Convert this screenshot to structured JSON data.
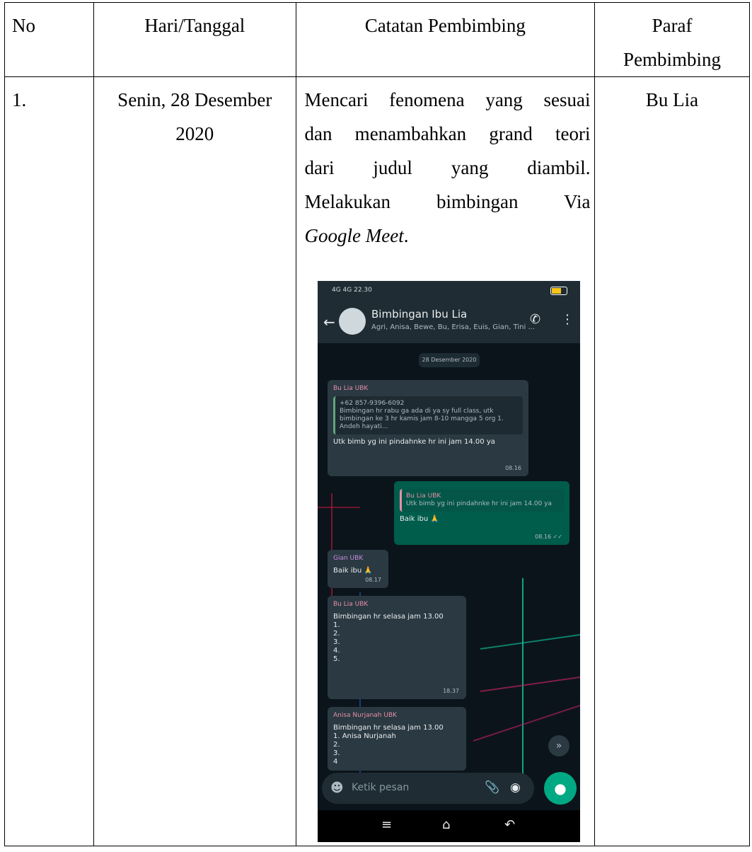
{
  "table": {
    "headers": {
      "no": "No",
      "date": "Hari/Tanggal",
      "note": "Catatan Pembimbing",
      "sign_line1": "Paraf",
      "sign_line2": "Pembimbing"
    },
    "rows": [
      {
        "no": "1.",
        "date_line1": "Senin, 28 Desember",
        "date_line2": "2020",
        "note_lines": [
          "Mencari fenomena yang sesuai",
          "dan menambahkan grand teori",
          "dari judul yang diambil.",
          "Melakukan bimbingan Via"
        ],
        "note_italic": "Google Meet",
        "note_italic_suffix": ".",
        "sign": "Bu Lia"
      }
    ]
  },
  "phone": {
    "status_left": "4G 4G 22.30",
    "group_name": "Bimbingan Ibu Lia",
    "members": "Agri, Anisa, Bewe, Bu, Erisa, Euis, Gian, Tini ...",
    "date_chip": "28 Desember 2020",
    "messages": [
      {
        "sender": "Bu Lia UBK",
        "quote_head": "+62 857-9396-6092",
        "quote_body": "Bimbingan hr rabu ga ada di ya sy full class, utk bimbingan ke 3 hr kamis jam 8-10 mangga 5 org 1. Andeh hayati...",
        "text": "Utk bimb yg ini pindahnke hr ini jam 14.00 ya",
        "time": "08.16"
      },
      {
        "quote_head": "Bu Lia UBK",
        "quote_body": "Utk bimb yg ini pindahnke hr ini jam 14.00 ya",
        "text": "Baik ibu 🙏",
        "time": "08.16 ✓✓"
      },
      {
        "sender": "Gian UBK",
        "text": "Baik ibu 🙏",
        "time": "08.17"
      },
      {
        "sender": "Bu Lia UBK",
        "text": "Bimbingan hr selasa jam 13.00\n1.\n2.\n3.\n4.\n5.",
        "time": "18.37"
      },
      {
        "sender": "Anisa Nurjanah UBK",
        "text": "Bimbingan hr selasa jam 13.00\n1. Anisa Nurjanah\n2.\n3.\n4"
      }
    ],
    "input_placeholder": "Ketik pesan"
  }
}
